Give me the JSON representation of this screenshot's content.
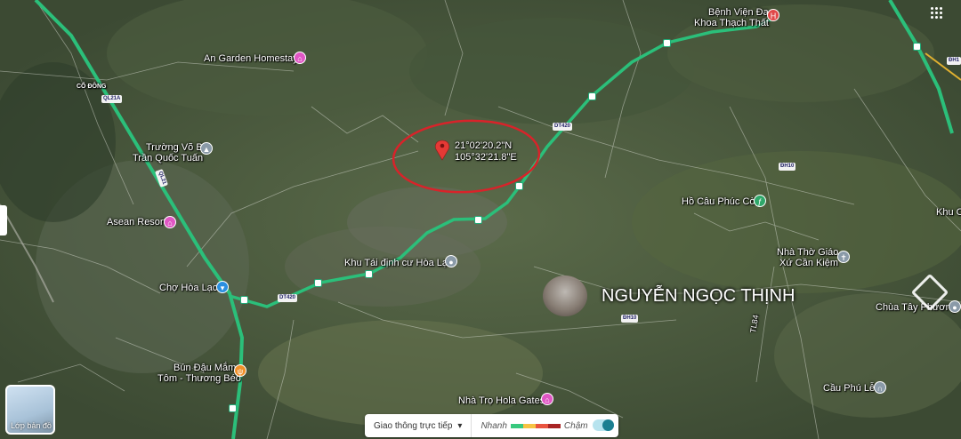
{
  "map": {
    "labels": {
      "co_dong": "CỔ ĐÔNG",
      "an_garden": "An Garden Homestay",
      "truong_vo_bi_1": "Trường Võ Bị",
      "truong_vo_bi_2": "Trần Quốc Tuấn",
      "asean_resort": "Asean Resort",
      "cho_hoa_lac": "Chợ Hòa Lạc",
      "bun_dau_1": "Bún Đậu Mắm",
      "bun_dau_2": "Tôm - Thương Béo",
      "khu_tai_dinh_cu": "Khu Tái định cư Hòa Lạc",
      "nha_tro": "Nhà Trọ Hola Gates",
      "benh_vien_1": "Bệnh Viện Đa",
      "benh_vien_2": "Khoa Thạch Thất",
      "ho_cau": "Hồ Câu Phúc Còi",
      "nha_tho_1": "Nhà Thờ Giáo",
      "nha_tho_2": "Xứ Cần Kiệm",
      "chua_tay_phuong": "Chùa Tây Phương",
      "cau_phu_le": "Cầu Phú Lễ",
      "khu_c": "Khu C",
      "tl_road": "TL84"
    },
    "road_shields": {
      "ql21a": "QL21A",
      "ql21": "QL21",
      "dt420_a": "DT420",
      "dt420_b": "DT420",
      "dh10_a": "ĐH10",
      "dh10_b": "ĐH10",
      "dh1": "ĐH1"
    },
    "coordinates": {
      "lat": "21°02'20.2\"N",
      "lng": "105°32'21.8\"E"
    },
    "watermark": "NGUYỄN NGỌC THỊNH",
    "icons": {
      "hotel": "hotel-icon",
      "school": "school-icon",
      "market": "shopping-cart-icon",
      "food": "restaurant-icon",
      "place": "place-icon",
      "hospital": "hospital-icon",
      "fishing": "fishing-icon",
      "church": "church-icon",
      "bridge": "bridge-icon",
      "pin": "location-pin-icon"
    },
    "colors": {
      "highway": "#2bbf7a",
      "annotation": "#d8232a",
      "hotel": "#e056c4",
      "hospital": "#e04848",
      "food": "#f0902a",
      "market": "#2a8fe0",
      "poi_grey": "#8a9aa8",
      "fishing": "#2fa86a"
    }
  },
  "controls": {
    "layers_label": "Lớp bản đồ",
    "traffic_label": "Giao thông trực tiếp",
    "fast_label": "Nhanh",
    "slow_label": "Chậm",
    "traffic_colors": [
      "#38c97e",
      "#f6c343",
      "#e9543f",
      "#a82424"
    ]
  }
}
